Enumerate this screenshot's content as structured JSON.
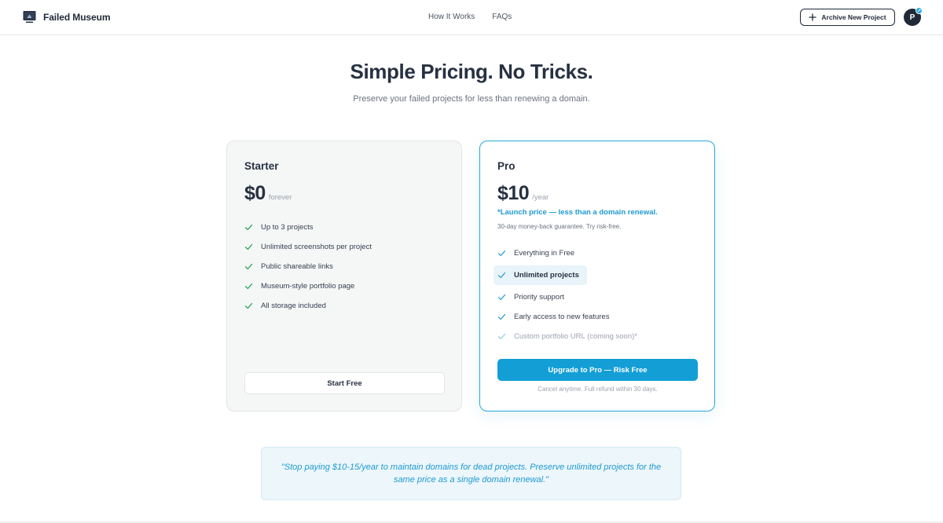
{
  "brand": {
    "name": "Failed Museum",
    "logo_icon": "museum-monitor-icon"
  },
  "nav": {
    "links": [
      "How It Works",
      "FAQs"
    ]
  },
  "header": {
    "archive_button_label": "Archive New Project",
    "archive_button_icon": "plus-icon",
    "avatar_initial": "P",
    "avatar_badge_icon": "expand-arrows-icon"
  },
  "hero": {
    "title": "Simple Pricing. No Tricks.",
    "subtitle": "Preserve your failed projects for less than renewing a domain."
  },
  "plans": {
    "starter": {
      "name": "Starter",
      "price": "$0",
      "period": "forever",
      "features": [
        "Up to 3 projects",
        "Unlimited screenshots per project",
        "Public shareable links",
        "Museum-style portfolio page",
        "All storage included"
      ],
      "cta_label": "Start Free"
    },
    "pro": {
      "name": "Pro",
      "price": "$10",
      "period": "/year",
      "launch_note": "*Launch price — less than a domain renewal.",
      "guarantee": "30-day money-back guarantee. Try risk-free.",
      "features": [
        "Everything in Free",
        "Unlimited projects",
        "Priority support",
        "Early access to new features",
        "Custom portfolio URL (coming soon)*"
      ],
      "cta_label": "Upgrade to Pro — Risk Free",
      "cancel_note": "Cancel anytime. Full refund within 30 days."
    }
  },
  "quote": {
    "text": "\"Stop paying $10-15/year to maintain domains for dead projects. Preserve unlimited projects for the same price as a single domain renewal.\""
  },
  "colors": {
    "accent": "#139fd6",
    "accent_text": "#1f9ad1",
    "check_starter": "#16a34a",
    "check_pro": "#1f9ad1",
    "heading": "#273142"
  }
}
